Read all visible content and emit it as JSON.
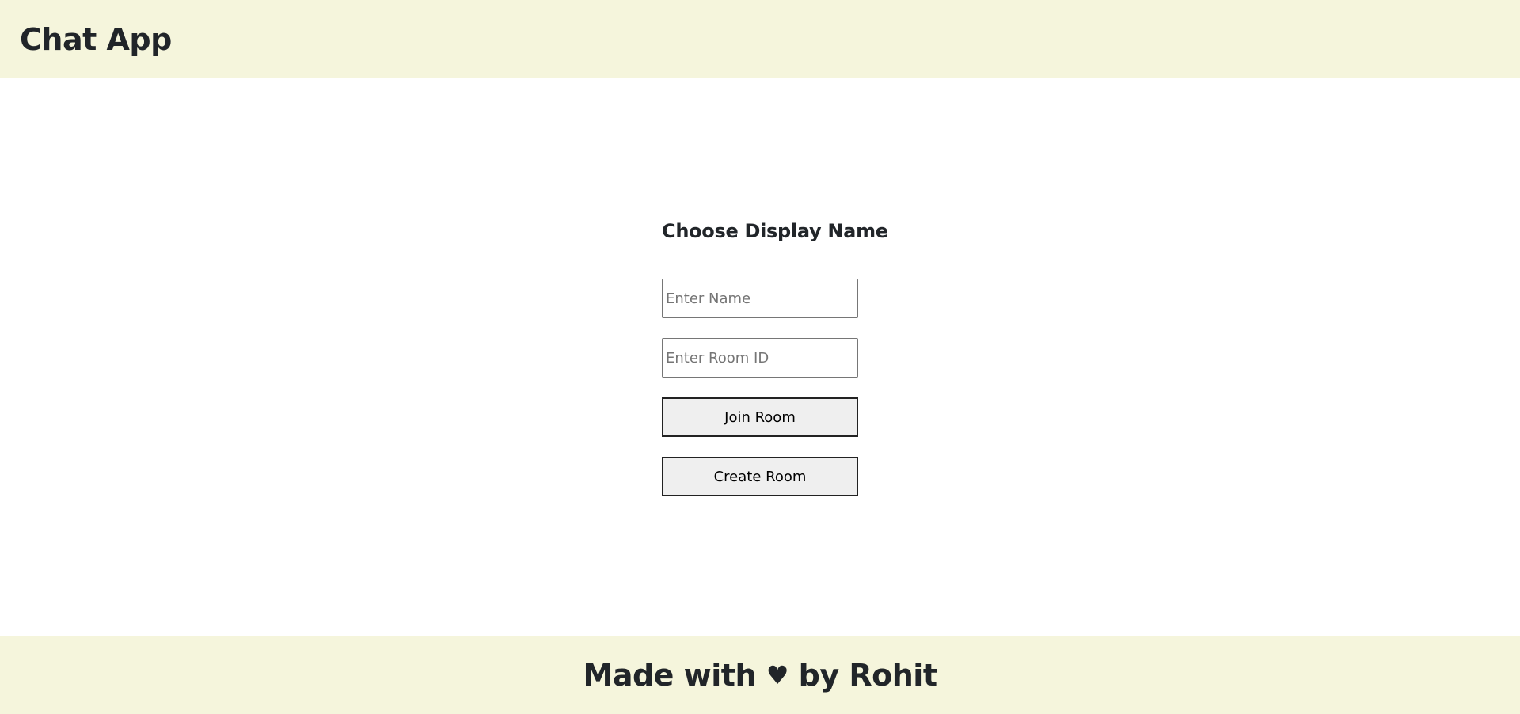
{
  "header": {
    "title": "Chat App"
  },
  "form": {
    "title": "Choose Display Name",
    "name_placeholder": "Enter Name",
    "name_value": "",
    "room_placeholder": "Enter Room ID",
    "room_value": "",
    "join_label": "Join Room",
    "create_label": "Create Room"
  },
  "footer": {
    "prefix": "Made with ",
    "heart_icon": "♥",
    "suffix": " by Rohit"
  },
  "colors": {
    "header_bg": "#f5f5dc",
    "footer_bg": "#f5f5dc",
    "text": "#212529",
    "button_bg": "#efefef"
  }
}
